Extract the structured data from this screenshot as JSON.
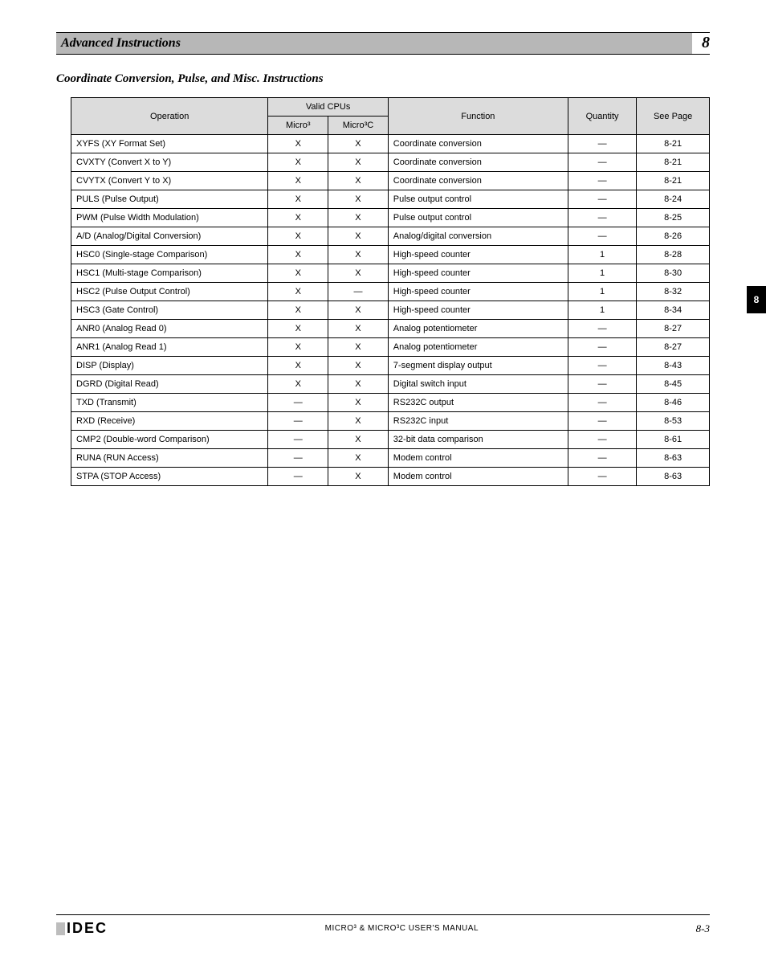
{
  "header": {
    "section_title": "Advanced Instructions",
    "chapter": "8"
  },
  "subtitle": "Coordinate Conversion, Pulse, and Misc. Instructions",
  "side_tab": "8",
  "table": {
    "headers": {
      "operation": "Operation",
      "valid_cpus": "Valid CPUs",
      "micro3": "Micro³",
      "micro3c": "Micro³C",
      "function": "Function",
      "quantity": "Quantity",
      "see_page": "See Page"
    },
    "rows": [
      {
        "op": "XYFS (XY Format Set)",
        "m3": "X",
        "m3c": "X",
        "func": "Coordinate conversion",
        "qty": "—",
        "page": "8-21"
      },
      {
        "op": "CVXTY (Convert X to Y)",
        "m3": "X",
        "m3c": "X",
        "func": "Coordinate conversion",
        "qty": "—",
        "page": "8-21"
      },
      {
        "op": "CVYTX (Convert Y to X)",
        "m3": "X",
        "m3c": "X",
        "func": "Coordinate conversion",
        "qty": "—",
        "page": "8-21"
      },
      {
        "op": "PULS (Pulse Output)",
        "m3": "X",
        "m3c": "X",
        "func": "Pulse output control",
        "qty": "—",
        "page": "8-24"
      },
      {
        "op": "PWM (Pulse Width Modulation)",
        "m3": "X",
        "m3c": "X",
        "func": "Pulse output control",
        "qty": "—",
        "page": "8-25"
      },
      {
        "op": "A/D (Analog/Digital Conversion)",
        "m3": "X",
        "m3c": "X",
        "func": "Analog/digital conversion",
        "qty": "—",
        "page": "8-26"
      },
      {
        "op": "HSC0 (Single-stage Comparison)",
        "m3": "X",
        "m3c": "X",
        "func": "High-speed counter",
        "qty": "1",
        "page": "8-28"
      },
      {
        "op": "HSC1 (Multi-stage Comparison)",
        "m3": "X",
        "m3c": "X",
        "func": "High-speed counter",
        "qty": "1",
        "page": "8-30"
      },
      {
        "op": "HSC2 (Pulse Output Control)",
        "m3": "X",
        "m3c": "—",
        "func": "High-speed counter",
        "qty": "1",
        "page": "8-32"
      },
      {
        "op": "HSC3 (Gate Control)",
        "m3": "X",
        "m3c": "X",
        "func": "High-speed counter",
        "qty": "1",
        "page": "8-34"
      },
      {
        "op": "ANR0 (Analog Read 0)",
        "m3": "X",
        "m3c": "X",
        "func": "Analog potentiometer",
        "qty": "—",
        "page": "8-27"
      },
      {
        "op": "ANR1 (Analog Read 1)",
        "m3": "X",
        "m3c": "X",
        "func": "Analog potentiometer",
        "qty": "—",
        "page": "8-27"
      },
      {
        "op": "DISP (Display)",
        "m3": "X",
        "m3c": "X",
        "func": "7-segment display output",
        "qty": "—",
        "page": "8-43"
      },
      {
        "op": "DGRD (Digital Read)",
        "m3": "X",
        "m3c": "X",
        "func": "Digital switch input",
        "qty": "—",
        "page": "8-45"
      },
      {
        "op": "TXD (Transmit)",
        "m3": "—",
        "m3c": "X",
        "func": "RS232C output",
        "qty": "—",
        "page": "8-46"
      },
      {
        "op": "RXD (Receive)",
        "m3": "—",
        "m3c": "X",
        "func": "RS232C input",
        "qty": "—",
        "page": "8-53"
      },
      {
        "op": "CMP2 (Double-word Comparison)",
        "m3": "—",
        "m3c": "X",
        "func": "32-bit data comparison",
        "qty": "—",
        "page": "8-61"
      },
      {
        "op": "RUNA (RUN Access)",
        "m3": "—",
        "m3c": "X",
        "func": "Modem control",
        "qty": "—",
        "page": "8-63"
      },
      {
        "op": "STPA (STOP Access)",
        "m3": "—",
        "m3c": "X",
        "func": "Modem control",
        "qty": "—",
        "page": "8-63"
      }
    ]
  },
  "footer": {
    "brand": "IDEC",
    "manual": "MICRO³ & MICRO³C  USER'S MANUAL",
    "pagenum": "8-3"
  }
}
